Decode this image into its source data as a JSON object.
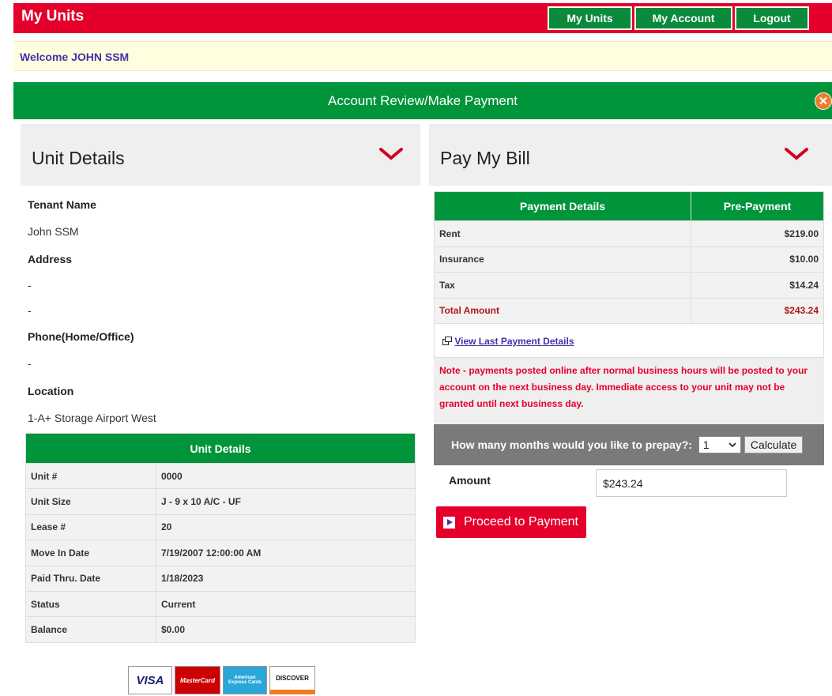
{
  "topbar": {
    "brand": "My Units",
    "nav": [
      "My Units",
      "My Account",
      "Logout"
    ]
  },
  "welcome": "Welcome JOHN SSM",
  "banner": {
    "title": "Account Review/Make Payment",
    "close_icon": "x"
  },
  "unit_panel": {
    "title": "Unit Details",
    "fields": {
      "tenant_label": "Tenant Name",
      "tenant_value": "John SSM",
      "address_label": "Address",
      "address_line1": "-",
      "address_line2": "-",
      "phone_label": "Phone(Home/Office)",
      "phone_value": "-",
      "location_label": "Location",
      "location_value": "1-A+ Storage Airport West"
    },
    "table": {
      "header": "Unit Details",
      "rows": [
        {
          "k": "Unit #",
          "v": "0000"
        },
        {
          "k": "Unit Size",
          "v": "J - 9 x 10 A/C - UF"
        },
        {
          "k": "Lease #",
          "v": "20"
        },
        {
          "k": "Move In Date",
          "v": "7/19/2007 12:00:00 AM"
        },
        {
          "k": "Paid Thru. Date",
          "v": "1/18/2023"
        },
        {
          "k": "Status",
          "v": "Current"
        },
        {
          "k": "Balance",
          "v": "$0.00"
        }
      ]
    }
  },
  "pay_panel": {
    "title": "Pay My Bill",
    "table": {
      "headers": [
        "Payment Details",
        "Pre-Payment"
      ],
      "rows": [
        {
          "k": "Rent",
          "v": "$219.00"
        },
        {
          "k": "Insurance",
          "v": "$10.00"
        },
        {
          "k": "Tax",
          "v": "$14.24"
        },
        {
          "k": "Total Amount",
          "v": "$243.24"
        }
      ]
    },
    "last_payment_link": "View Last Payment Details",
    "note": "Note - payments posted online after normal business hours will be posted to your account on the next business day. Immediate access to your unit may not be granted until next business day.",
    "prepay_label": "How many months would you like to prepay?:",
    "prepay_value": "1",
    "calculate_label": "Calculate",
    "amount_label": "Amount",
    "amount_value": "$243.24",
    "proceed_label": "Proceed to Payment"
  },
  "cards": [
    "VISA",
    "MasterCard",
    "American Express Cards",
    "DISCOVER"
  ],
  "colors": {
    "brand_red": "#e4002b",
    "green": "#00953b",
    "welcome_bg": "#ffffe0",
    "note_red": "#e4002b",
    "panel_gray": "#efefef"
  }
}
